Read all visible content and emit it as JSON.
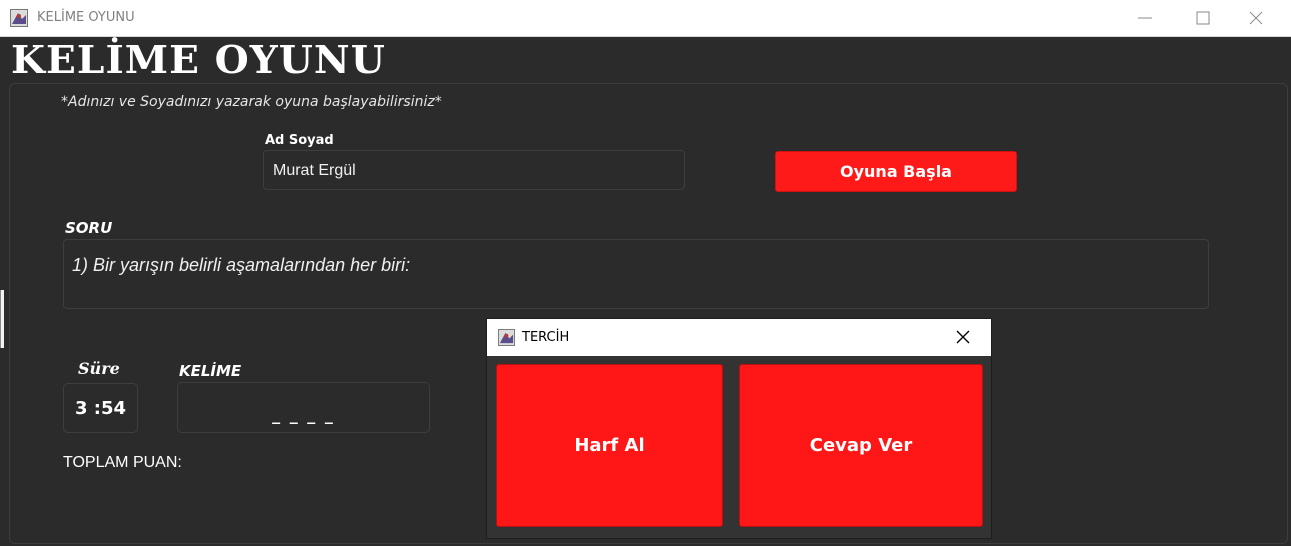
{
  "window": {
    "title": "KELİME OYUNU",
    "icon": "app-game-icon",
    "controls": [
      "minimize-icon",
      "maximize-icon",
      "close-icon"
    ]
  },
  "heading": "KELİME OYUNU",
  "hint": "*Adınızı ve Soyadınızı yazarak oyuna başlayabilirsiniz*",
  "name_section": {
    "label": "Ad Soyad",
    "value": "Murat Ergül"
  },
  "start_button": "Oyuna Başla",
  "question": {
    "label": "SORU",
    "text": "1) Bir yarışın belirli aşamalarından her biri:"
  },
  "timer": {
    "label": "Süre",
    "value": "3 :54"
  },
  "word": {
    "label": "KELİME",
    "value": "_ _ _ _"
  },
  "score": {
    "label": "TOPLAM PUAN:"
  },
  "dialog": {
    "title": "TERCİH",
    "buttons": [
      "Harf Al",
      "Cevap Ver"
    ]
  },
  "colors": {
    "background": "#2b2b2b",
    "accent_red": "#ff1a1a",
    "text": "#ffffff"
  }
}
